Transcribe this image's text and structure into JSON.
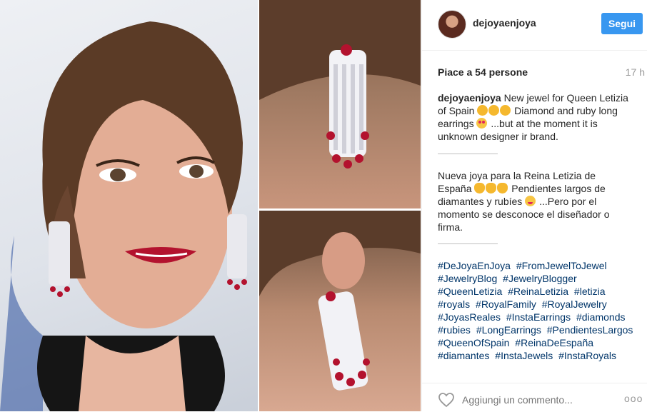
{
  "post": {
    "username": "dejoyaenjoya",
    "follow_label": "Segui",
    "likes_label": "Piace a 54 persone",
    "time_label": "17 h",
    "caption_user": "dejoyaenjoya",
    "caption_en_1": "New jewel for Queen Letizia of Spain",
    "caption_en_2": "Diamond and ruby long earrings",
    "caption_en_3": "...but at the moment it is unknown designer ir brand.",
    "caption_es_1": "Nueva joya para la Reina Letizia de España",
    "caption_es_2": "Pendientes largos de diamantes y rubíes",
    "caption_es_3": "...Pero por el momento se desconoce el diseñador o firma.",
    "hashtags": [
      "#DeJoyaEnJoya",
      "#FromJewelToJewel",
      "#JewelryBlog",
      "#JewelryBlogger",
      "#QueenLetizia",
      "#ReinaLetizia",
      "#letizia",
      "#royals",
      "#RoyalFamily",
      "#RoyalJewelry",
      "#JoyasReales",
      "#InstaEarrings",
      "#diamonds",
      "#rubies",
      "#LongEarrings",
      "#PendientesLargos",
      "#QueenOfSpain",
      "#ReinaDeEspaña",
      "#diamantes",
      "#InstaJewels",
      "#InstaRoyals"
    ],
    "comment_placeholder": "Aggiungi un commento...",
    "more_label": "ooo"
  },
  "icons": {
    "like": "heart-outline-icon",
    "more": "more-options-icon"
  },
  "colors": {
    "accent": "#3897f0",
    "hashtag": "#003569",
    "ruby": "#b3122e"
  }
}
